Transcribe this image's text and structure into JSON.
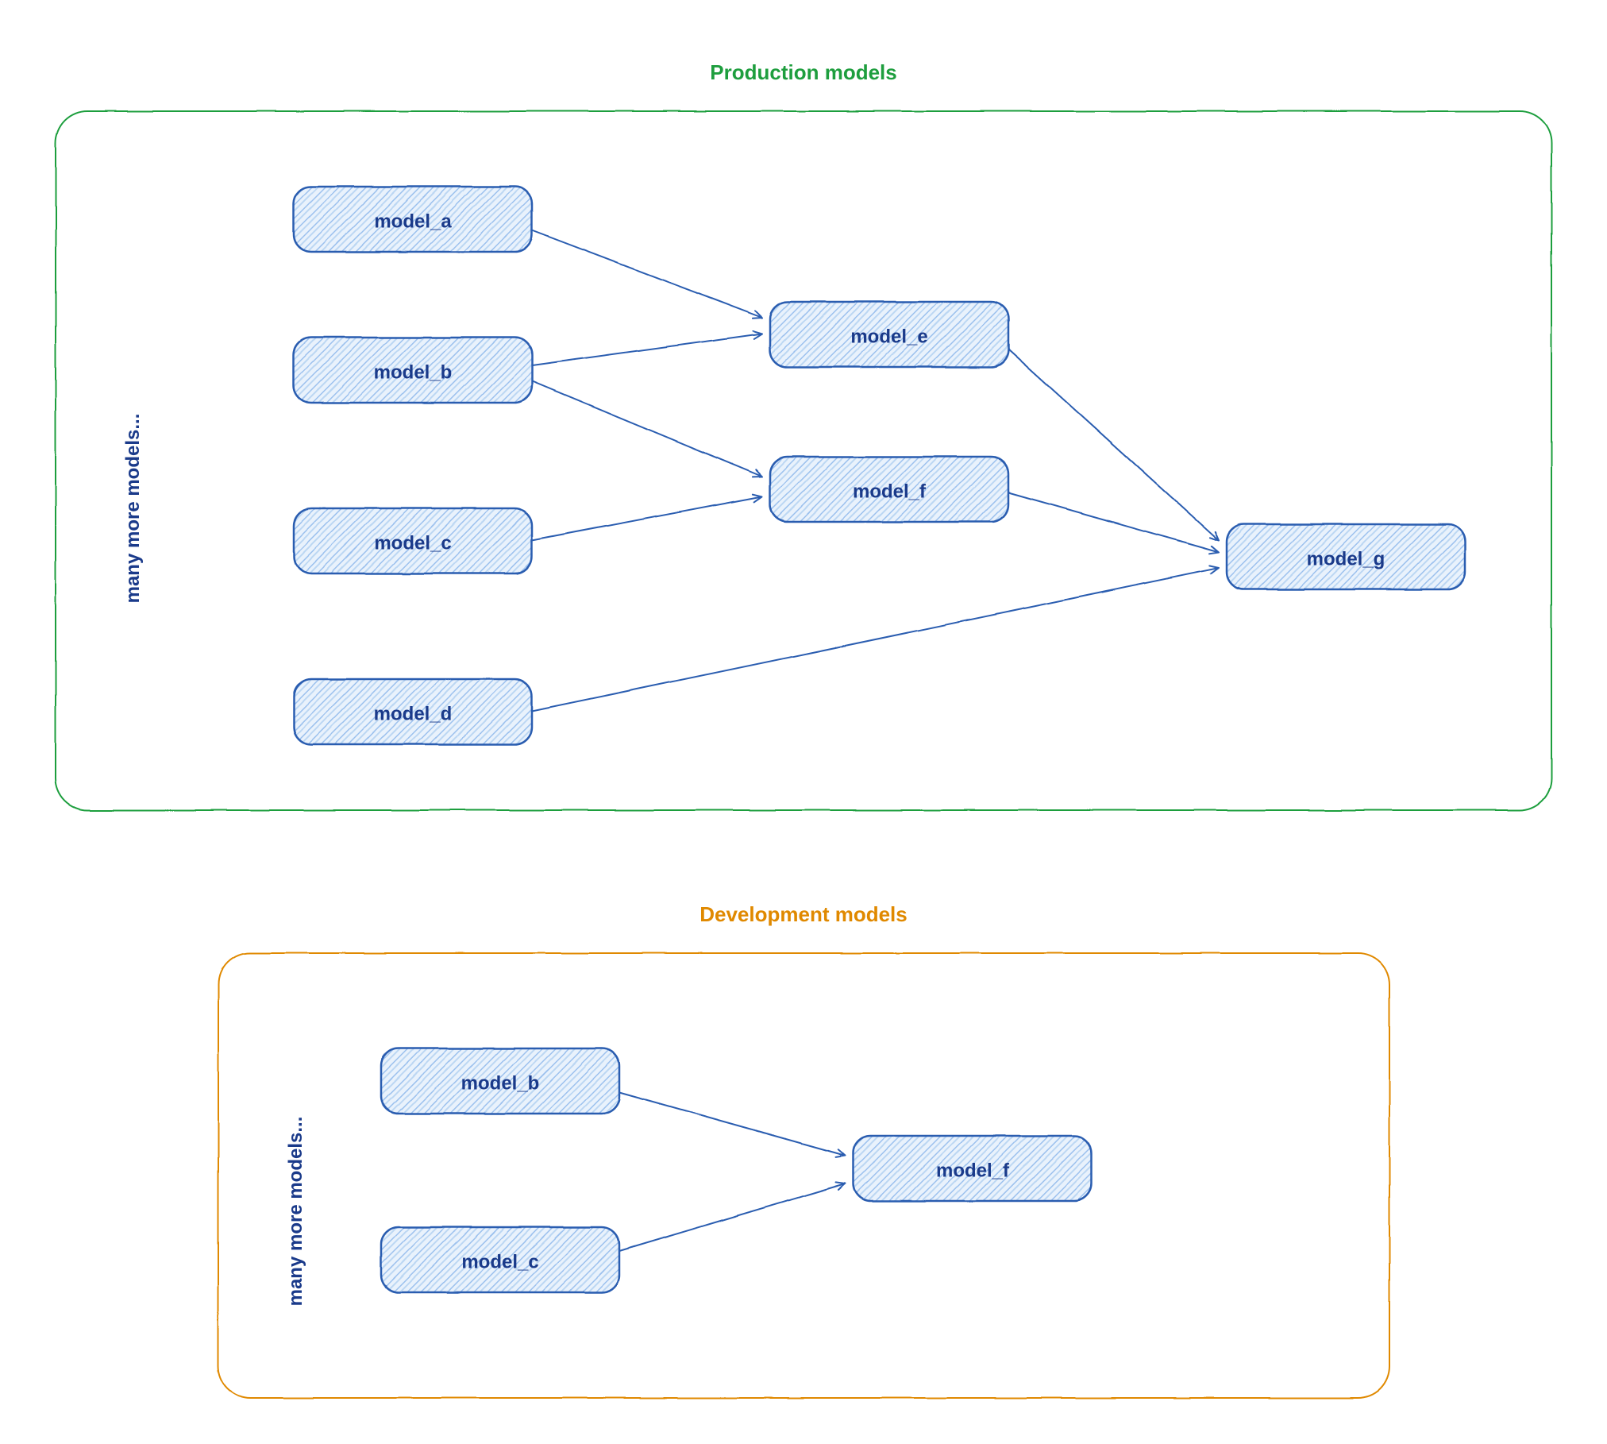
{
  "groups": {
    "production": {
      "title": "Production models",
      "side_note": "many more models...",
      "nodes": {
        "a": "model_a",
        "b": "model_b",
        "c": "model_c",
        "d": "model_d",
        "e": "model_e",
        "f": "model_f",
        "g": "model_g"
      },
      "edges": [
        [
          "a",
          "e"
        ],
        [
          "b",
          "e"
        ],
        [
          "b",
          "f"
        ],
        [
          "c",
          "f"
        ],
        [
          "e",
          "g"
        ],
        [
          "f",
          "g"
        ],
        [
          "d",
          "g"
        ]
      ]
    },
    "development": {
      "title": "Development models",
      "side_note": "many more models...",
      "nodes": {
        "b": "model_b",
        "c": "model_c",
        "f": "model_f"
      },
      "edges": [
        [
          "b",
          "f"
        ],
        [
          "c",
          "f"
        ]
      ]
    }
  },
  "chart_data": {
    "type": "diagram",
    "description": "Two labeled groups of model dependency DAGs drawn in a hand-sketch style.",
    "groups": [
      {
        "name": "Production models",
        "side_note": "many more models...",
        "nodes": [
          "model_a",
          "model_b",
          "model_c",
          "model_d",
          "model_e",
          "model_f",
          "model_g"
        ],
        "edges": [
          [
            "model_a",
            "model_e"
          ],
          [
            "model_b",
            "model_e"
          ],
          [
            "model_b",
            "model_f"
          ],
          [
            "model_c",
            "model_f"
          ],
          [
            "model_e",
            "model_g"
          ],
          [
            "model_f",
            "model_g"
          ],
          [
            "model_d",
            "model_g"
          ]
        ]
      },
      {
        "name": "Development models",
        "side_note": "many more models...",
        "nodes": [
          "model_b",
          "model_c",
          "model_f"
        ],
        "edges": [
          [
            "model_b",
            "model_f"
          ],
          [
            "model_c",
            "model_f"
          ]
        ]
      }
    ]
  },
  "colors": {
    "node_stroke": "#2b5db0",
    "node_fill_hatch": "#9cc1ee",
    "node_fill_bg": "#e9f2fc",
    "production_border": "#1e9e3e",
    "development_border": "#e08900",
    "text": "#1a3a8a"
  }
}
